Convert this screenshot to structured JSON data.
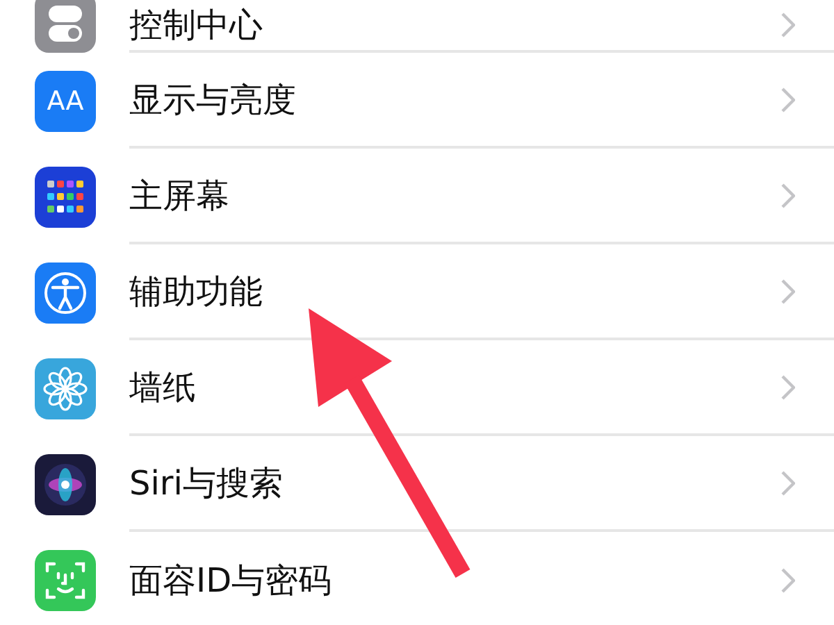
{
  "settings_list": [
    {
      "label": "控制中心"
    },
    {
      "label": "显示与亮度",
      "icon_label": "AA"
    },
    {
      "label": "主屏幕"
    },
    {
      "label": "辅助功能"
    },
    {
      "label": "墙纸"
    },
    {
      "label": "Siri与搜索"
    },
    {
      "label": "面容ID与密码"
    }
  ]
}
